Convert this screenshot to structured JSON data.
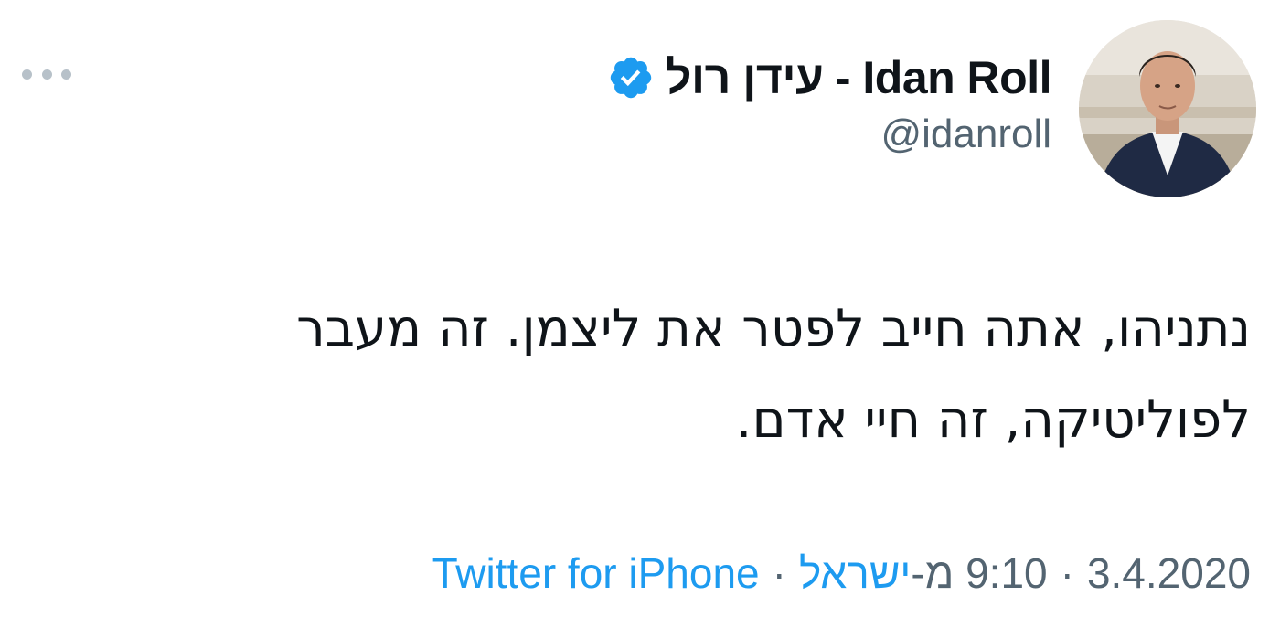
{
  "tweet": {
    "author": {
      "display_name": "עידן רול - Idan Roll",
      "handle": "@idanroll",
      "verified": true,
      "verified_color": "#1d9bf0"
    },
    "text_lines": [
      "נתניהו, אתה חייב לפטר את ליצמן. זה מעבר",
      "לפוליטיקה, זה חיי אדם."
    ],
    "meta": {
      "date": "3.4.2020",
      "separator": "·",
      "time_prefix": "9:10 מ-",
      "location": "ישראל",
      "source": "Twitter for iPhone"
    },
    "icons": {
      "more": "more-dots-icon",
      "verified": "verified-badge-icon"
    },
    "colors": {
      "link": "#1d9bf0",
      "secondary_text": "#536471",
      "primary_text": "#0f1419"
    }
  }
}
